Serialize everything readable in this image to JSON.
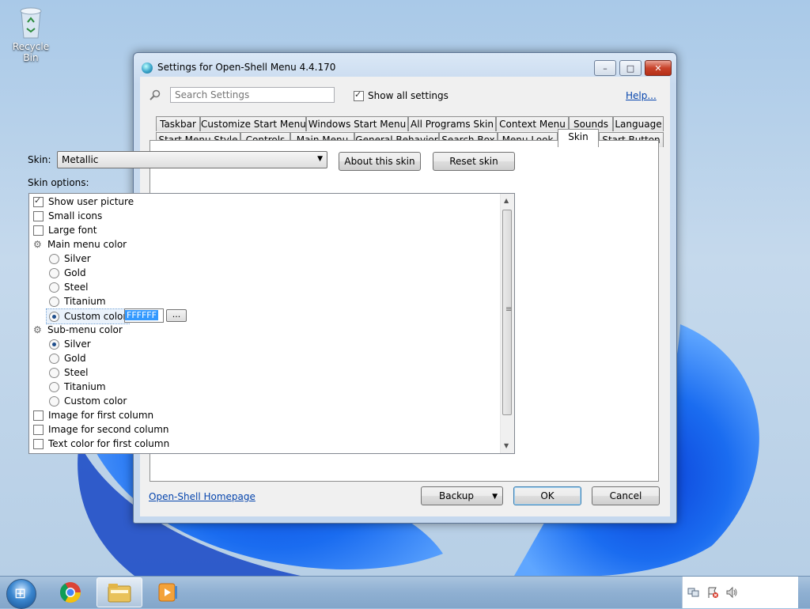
{
  "desktop": {
    "recycle_bin_label": "Recycle Bin"
  },
  "window": {
    "title": "Settings for Open-Shell Menu 4.4.170",
    "caption": {
      "minimize": "–",
      "maximize": "□",
      "close": "✕"
    }
  },
  "toolbar": {
    "search_placeholder": "Search Settings",
    "show_all_label": "Show all settings",
    "show_all_checked": true,
    "help_link": "Help..."
  },
  "tabs": {
    "row1": [
      "Taskbar",
      "Customize Start Menu",
      "Windows Start Menu",
      "All Programs Skin",
      "Context Menu",
      "Sounds",
      "Language"
    ],
    "row2": [
      "Start Menu Style",
      "Controls",
      "Main Menu",
      "General Behavior",
      "Search Box",
      "Menu Look",
      "Skin",
      "Start Button"
    ],
    "active": "Skin"
  },
  "skin": {
    "label": "Skin:",
    "selected": "Metallic",
    "about_button": "About this skin",
    "reset_button": "Reset skin",
    "options_label": "Skin options:"
  },
  "options": {
    "show_user_picture": "Show user picture",
    "small_icons": "Small icons",
    "large_font": "Large font",
    "main_menu_color": "Main menu color",
    "main_silver": "Silver",
    "main_gold": "Gold",
    "main_steel": "Steel",
    "main_titanium": "Titanium",
    "main_custom": "Custom color",
    "custom_color_value": "FFFFFF",
    "browse_label": "...",
    "sub_menu_color": "Sub-menu color",
    "sub_silver": "Silver",
    "sub_gold": "Gold",
    "sub_steel": "Steel",
    "sub_titanium": "Titanium",
    "sub_custom": "Custom color",
    "image_first_column": "Image for first column",
    "image_second_column": "Image for second column",
    "text_color_first_column": "Text color for first column"
  },
  "footer": {
    "homepage_link": "Open-Shell Homepage",
    "backup_button": "Backup",
    "ok_button": "OK",
    "cancel_button": "Cancel"
  },
  "colors": {
    "accent": "#3399ff",
    "link": "#0645ad",
    "close": "#c8432b"
  }
}
